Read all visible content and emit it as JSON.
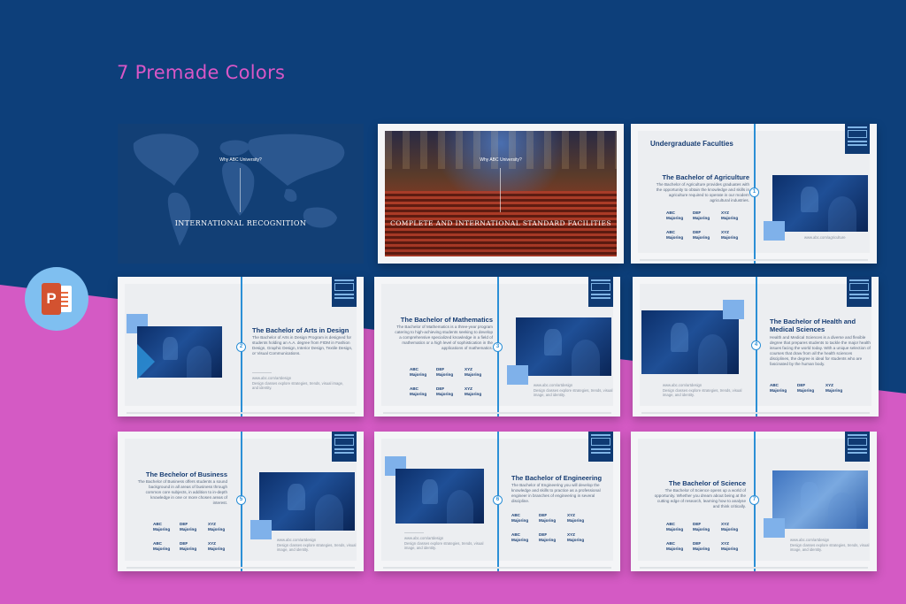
{
  "heading": "7 Premade Colors",
  "colors": {
    "background": "#0d3f7a",
    "pink": "#d957c6",
    "accent": "#2b8fd6",
    "navy": "#173d73"
  },
  "ppt_icon": {
    "name": "powerpoint-icon",
    "letter": "P"
  },
  "slides": {
    "map": {
      "sub": "Why ABC University?",
      "title": "INTERNATIONAL RECOGNITION"
    },
    "facilities": {
      "sub": "Why ABC University?",
      "title": "COMPLETE AND INTERNATIONAL STANDARD FACILITIES"
    },
    "agriculture": {
      "section": "Undergraduate Faculties",
      "title": "The Bachelor of Agriculture",
      "body": "The Bachelor of Agriculture provides graduates with the opportunity to obtain the knowledge and skills in agriculture required to operate in our modern agricultural industries.",
      "number": "1",
      "site": "www.abc.com/agriculture"
    },
    "arts": {
      "title": "The Bachelor of Arts in Design",
      "body": "The Bachelor of Arts in Design Program is designed for students holding an A.A. degree from FIDM in Fashion Design, Graphic Design, Interior Design, Textile Design, or Visual Communications.",
      "number": "2",
      "site": "www.abc.com/artdesign",
      "site_desc": "Design classes explore strategies, trends, visual image, and identity."
    },
    "math": {
      "title": "The Bachelor of Mathematics",
      "body": "The Bachelor of Mathematics is a three-year program catering to high-achieving students seeking to develop a comprehensive specialized knowledge in a field of mathematics or a high level of sophistication in the applications of mathematics.",
      "number": "3",
      "site": "www.abc.com/artdesign",
      "site_desc": "Design classes explore strategies, trends, visual image, and identity."
    },
    "health": {
      "title": "The Bachelor of Health and Medical Sciences",
      "body": "Health and Medical Sciences is a diverse and flexible degree that prepares students to tackle the major health issues facing the world today. With a unique selection of courses that draw from all the health sciences disciplines, the degree is ideal for students who are fascinated by the human body.",
      "number": "4",
      "site": "www.abc.com/artdesign",
      "site_desc": "Design classes explore strategies, trends, visual image, and identity."
    },
    "business": {
      "title": "The Bechelor of Business",
      "body": "The Bachelor of Business offers students a sound background in all areas of business through common core subjects, in addition to in-depth knowledge in one or more chosen areas of interest.",
      "number": "5",
      "site": "www.abc.com/artdesign",
      "site_desc": "Design classes explore strategies, trends, visual image, and identity."
    },
    "engineering": {
      "title": "The Bachelor of Engineering",
      "body": "The Bachelor of Engineering you will develop the knowledge and skills to practice as a professional engineer in branches of engineering in several discipline.",
      "number": "6",
      "site": "www.abc.com/artdesign",
      "site_desc": "Design classes explore strategies, trends, visual image, and identity."
    },
    "science": {
      "title": "The Bachelor of Science",
      "body": "The Bachelor of Science opens up a world of opportunity. Whether you dream about being at the cutting edge of research, learning how to analyse and think critically.",
      "number": "7",
      "site": "www.abc.com/artdesign",
      "site_desc": "Design classes explore strategies, trends, visual image, and identity."
    }
  },
  "majors": {
    "a": "ABC",
    "d": "DEF",
    "x": "XYZ",
    "label": "Majoring"
  }
}
